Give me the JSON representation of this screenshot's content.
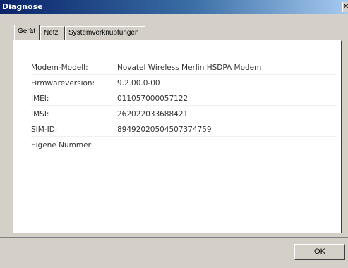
{
  "window": {
    "title": "Diagnose"
  },
  "tabs": [
    {
      "label": "Gerät",
      "active": true
    },
    {
      "label": "Netz",
      "active": false
    },
    {
      "label": "Systemverknüpfungen",
      "active": false
    }
  ],
  "fields": [
    {
      "label": "Modem-Modell:",
      "value": "Novatel Wireless Merlin HSDPA Modem"
    },
    {
      "label": "Firmwareversion:",
      "value": "9.2.00.0-00"
    },
    {
      "label": "IMEI:",
      "value": "011057000057122"
    },
    {
      "label": "IMSI:",
      "value": "262022033688421"
    },
    {
      "label": "SIM-ID:",
      "value": "89492020504507374759"
    },
    {
      "label": "Eigene Nummer:",
      "value": ""
    }
  ],
  "buttons": {
    "ok": "OK"
  },
  "colors": {
    "title_bar": "#0a246a",
    "face": "#d4d0c8",
    "panel": "#ffffff"
  }
}
